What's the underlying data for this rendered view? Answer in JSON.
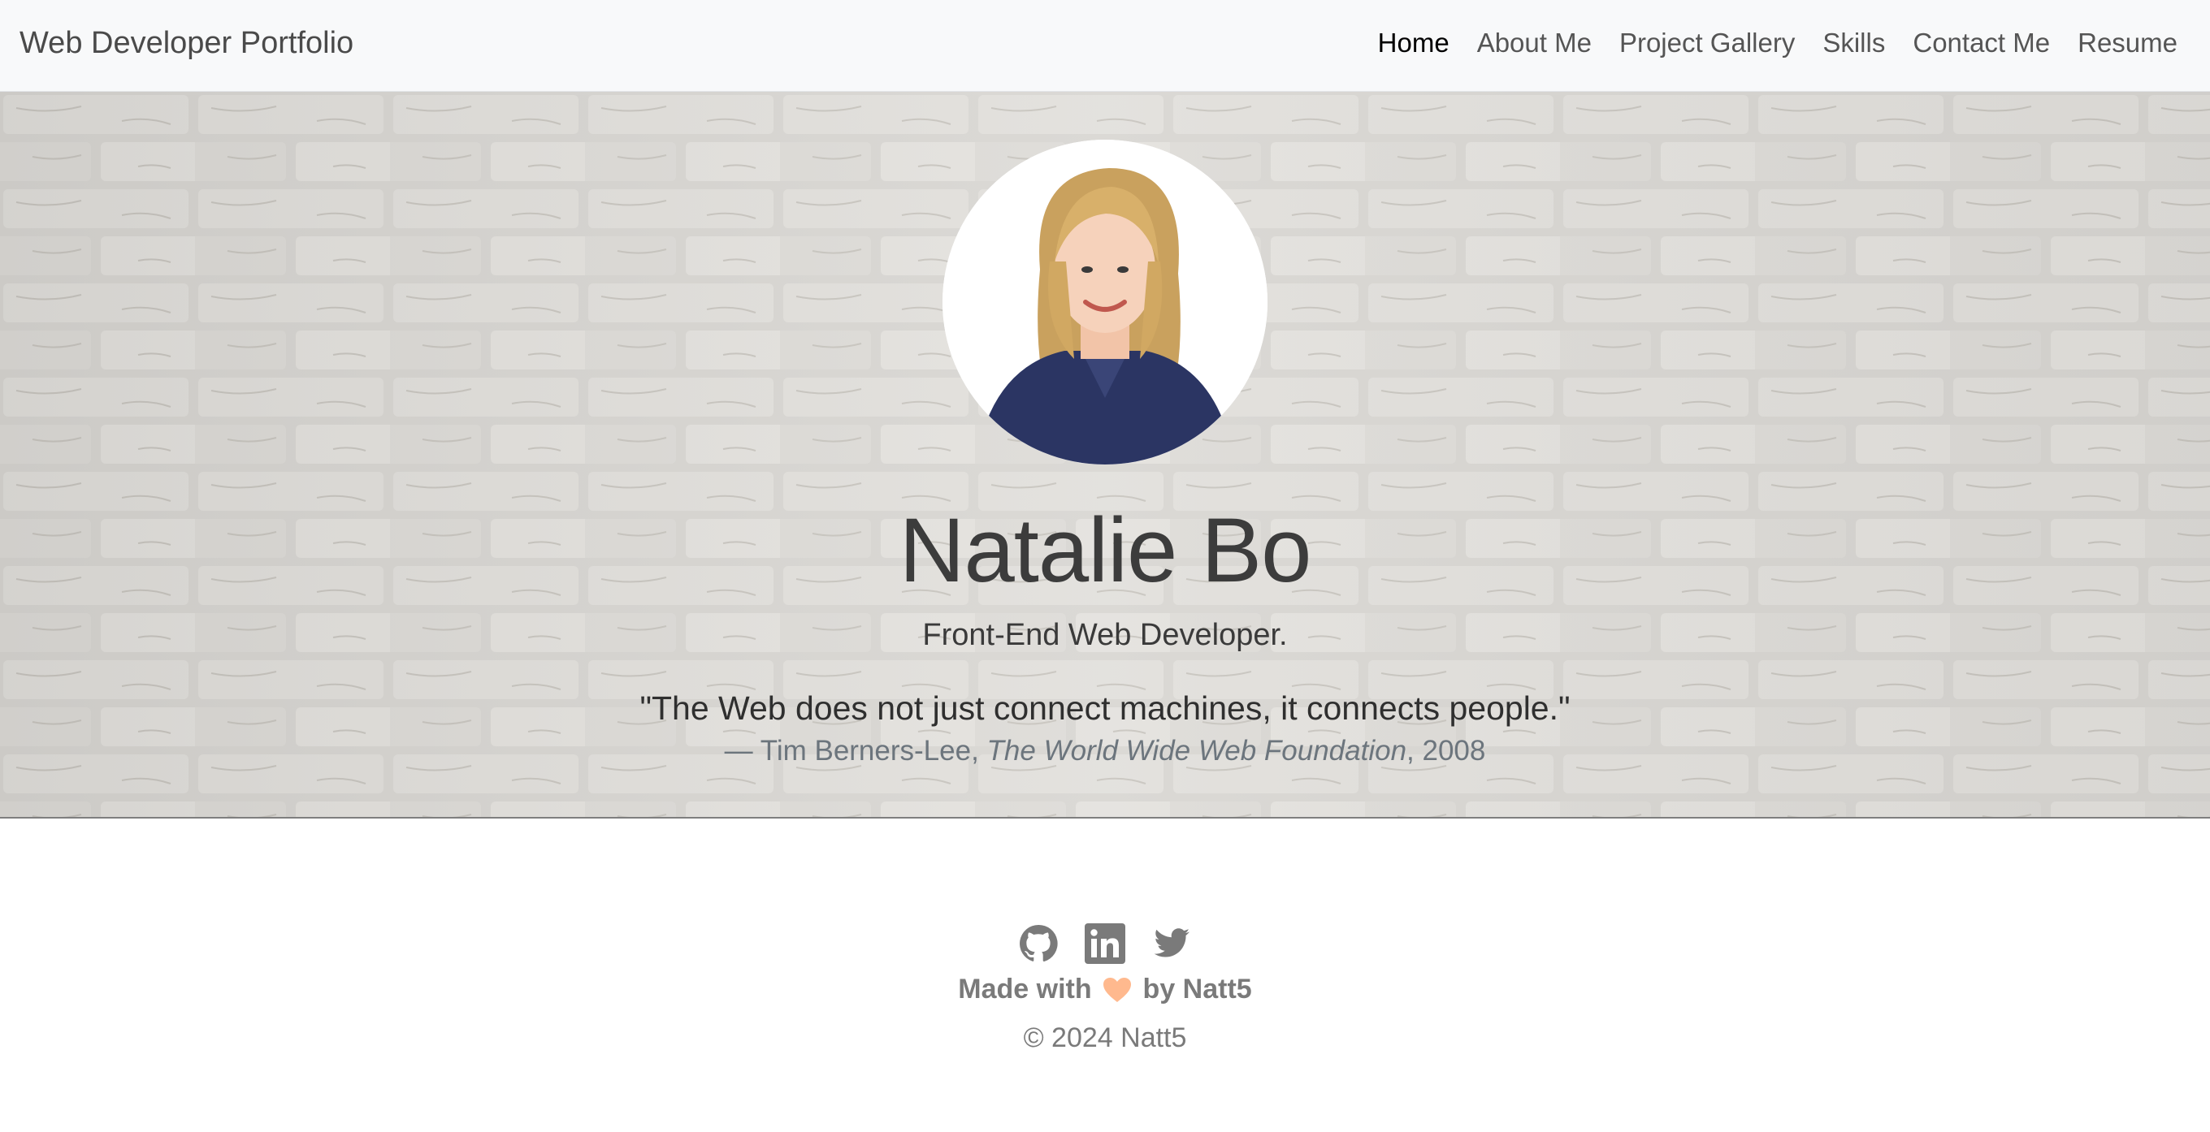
{
  "navbar": {
    "brand": "Web Developer Portfolio",
    "links": [
      {
        "label": "Home",
        "active": true
      },
      {
        "label": "About Me",
        "active": false
      },
      {
        "label": "Project Gallery",
        "active": false
      },
      {
        "label": "Skills",
        "active": false
      },
      {
        "label": "Contact Me",
        "active": false
      },
      {
        "label": "Resume",
        "active": false
      }
    ]
  },
  "hero": {
    "avatar_icon": "profile-photo",
    "name": "Natalie Bo",
    "role": "Front-End Web Developer.",
    "quote": "\"The Web does not just connect machines, it connects people.\"",
    "cite_prefix": "— Tim Berners-Lee, ",
    "cite_source": "The World Wide Web Foundation",
    "cite_year": ", 2008"
  },
  "footer": {
    "social": [
      {
        "name": "github-icon"
      },
      {
        "name": "linkedin-icon"
      },
      {
        "name": "twitter-icon"
      }
    ],
    "made_prefix": "Made with",
    "made_suffix": "by Natt5",
    "copyright": "© 2024 Natt5"
  },
  "colors": {
    "nav_bg": "#f8f9fa",
    "active_link": "#000000",
    "muted_text": "#6c757d",
    "icon_gray": "#7a7a7a",
    "heart": "#ffb98e"
  }
}
